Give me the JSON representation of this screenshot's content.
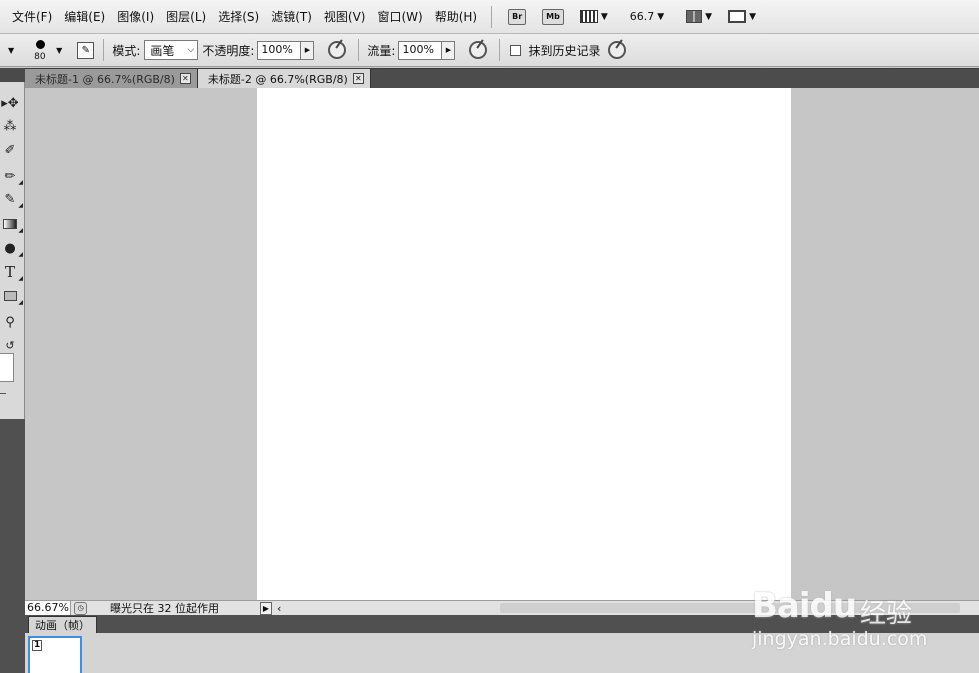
{
  "menubar": {
    "items": [
      "文件(F)",
      "编辑(E)",
      "图像(I)",
      "图层(L)",
      "选择(S)",
      "滤镜(T)",
      "视图(V)",
      "窗口(W)",
      "帮助(H)"
    ],
    "bridge_label": "Br",
    "minibridge_label": "Mb",
    "zoom_value": "66.7"
  },
  "options": {
    "brush_size": "80",
    "mode_label": "模式:",
    "mode_value": "画笔",
    "opacity_label": "不透明度:",
    "opacity_value": "100%",
    "flow_label": "流量:",
    "flow_value": "100%",
    "erase_history_label": "抹到历史记录"
  },
  "tabs": [
    {
      "label": "未标题-1 @ 66.7%(RGB/8)",
      "active": false
    },
    {
      "label": "未标题-2 @ 66.7%(RGB/8)",
      "active": true
    }
  ],
  "status": {
    "zoom": "66.67%",
    "message": "曝光只在 32 位起作用"
  },
  "animation": {
    "tab_label": "动画（帧）",
    "frame_number": "1"
  },
  "watermark": {
    "brand": "Baidu",
    "brand_cn": "经验",
    "url": "jingyan.baidu.com"
  },
  "tools": [
    "move-icon",
    "magic-wand-icon",
    "eyedropper-icon",
    "brush-icon",
    "history-brush-icon",
    "gradient-icon",
    "dodge-icon",
    "type-icon",
    "rectangle-icon",
    "zoom-icon",
    "swap-colors-icon"
  ],
  "colors": {
    "canvas_bg": "#c6c6c6",
    "canvas": "#ffffff",
    "panel_dark": "#4c4c4c",
    "frame_highlight": "#3e8ee6"
  }
}
